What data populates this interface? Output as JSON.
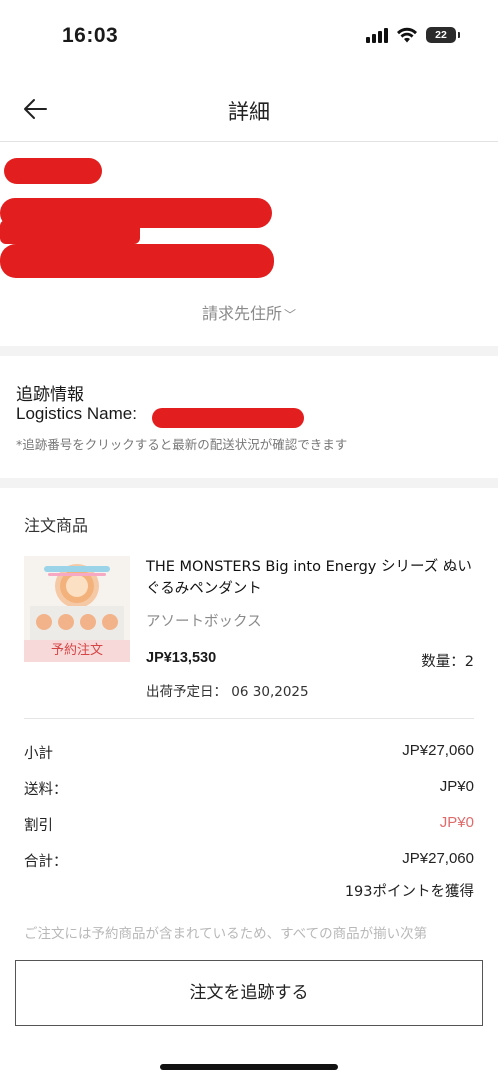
{
  "status_bar": {
    "time": "16:03",
    "battery": "22",
    "icons": [
      "cellular-signal-icon",
      "wifi-icon",
      "battery-icon"
    ]
  },
  "header": {
    "back_icon": "arrow-left-icon",
    "title": "詳細"
  },
  "address": {
    "billing_toggle_label": "請求先住所",
    "billing_toggle_icon": "chevron-down-icon"
  },
  "tracking": {
    "title": "追跡情報",
    "logistics_label": "Logistics Name:",
    "note": "*追跡番号をクリックすると最新の配送状況が確認できます"
  },
  "order": {
    "title": "注文商品",
    "product": {
      "name": "THE MONSTERS Big into Energy シリーズ ぬいぐるみペンダント",
      "variant": "アソートボックス",
      "price": "JP¥13,530",
      "quantity": "数量：2",
      "ship_date": "出荷予定日： 06 30,2025",
      "tag": "予約注文"
    },
    "summary": {
      "subtotal_label": "小計",
      "subtotal_value": "JP¥27,060",
      "shipping_label": "送料：",
      "shipping_value": "JP¥0",
      "discount_label": "割引",
      "discount_value": "JP¥0",
      "total_label": "合計：",
      "total_value": "JP¥27,060",
      "points": "193ポイントを獲得"
    },
    "notice": "ご注文には予約商品が含まれているため、すべての商品が揃い次第"
  },
  "actions": {
    "track_order": "注文を追跡する"
  },
  "colors": {
    "discount": "#e06b6b",
    "preorder_tag_bg": "#f7d9d9",
    "preorder_tag_text": "#d64545",
    "redaction": "#e21e1e"
  }
}
